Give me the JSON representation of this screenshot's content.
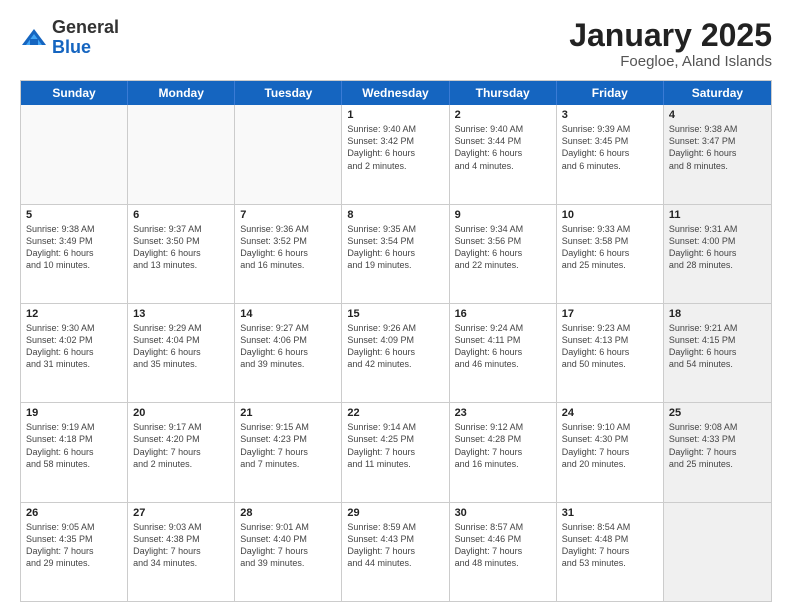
{
  "logo": {
    "general": "General",
    "blue": "Blue"
  },
  "title": "January 2025",
  "subtitle": "Foegloe, Aland Islands",
  "days": [
    "Sunday",
    "Monday",
    "Tuesday",
    "Wednesday",
    "Thursday",
    "Friday",
    "Saturday"
  ],
  "weeks": [
    [
      {
        "day": "",
        "info": "",
        "empty": true
      },
      {
        "day": "",
        "info": "",
        "empty": true
      },
      {
        "day": "",
        "info": "",
        "empty": true
      },
      {
        "day": "1",
        "info": "Sunrise: 9:40 AM\nSunset: 3:42 PM\nDaylight: 6 hours\nand 2 minutes."
      },
      {
        "day": "2",
        "info": "Sunrise: 9:40 AM\nSunset: 3:44 PM\nDaylight: 6 hours\nand 4 minutes."
      },
      {
        "day": "3",
        "info": "Sunrise: 9:39 AM\nSunset: 3:45 PM\nDaylight: 6 hours\nand 6 minutes."
      },
      {
        "day": "4",
        "info": "Sunrise: 9:38 AM\nSunset: 3:47 PM\nDaylight: 6 hours\nand 8 minutes.",
        "shaded": true
      }
    ],
    [
      {
        "day": "5",
        "info": "Sunrise: 9:38 AM\nSunset: 3:49 PM\nDaylight: 6 hours\nand 10 minutes."
      },
      {
        "day": "6",
        "info": "Sunrise: 9:37 AM\nSunset: 3:50 PM\nDaylight: 6 hours\nand 13 minutes."
      },
      {
        "day": "7",
        "info": "Sunrise: 9:36 AM\nSunset: 3:52 PM\nDaylight: 6 hours\nand 16 minutes."
      },
      {
        "day": "8",
        "info": "Sunrise: 9:35 AM\nSunset: 3:54 PM\nDaylight: 6 hours\nand 19 minutes."
      },
      {
        "day": "9",
        "info": "Sunrise: 9:34 AM\nSunset: 3:56 PM\nDaylight: 6 hours\nand 22 minutes."
      },
      {
        "day": "10",
        "info": "Sunrise: 9:33 AM\nSunset: 3:58 PM\nDaylight: 6 hours\nand 25 minutes."
      },
      {
        "day": "11",
        "info": "Sunrise: 9:31 AM\nSunset: 4:00 PM\nDaylight: 6 hours\nand 28 minutes.",
        "shaded": true
      }
    ],
    [
      {
        "day": "12",
        "info": "Sunrise: 9:30 AM\nSunset: 4:02 PM\nDaylight: 6 hours\nand 31 minutes."
      },
      {
        "day": "13",
        "info": "Sunrise: 9:29 AM\nSunset: 4:04 PM\nDaylight: 6 hours\nand 35 minutes."
      },
      {
        "day": "14",
        "info": "Sunrise: 9:27 AM\nSunset: 4:06 PM\nDaylight: 6 hours\nand 39 minutes."
      },
      {
        "day": "15",
        "info": "Sunrise: 9:26 AM\nSunset: 4:09 PM\nDaylight: 6 hours\nand 42 minutes."
      },
      {
        "day": "16",
        "info": "Sunrise: 9:24 AM\nSunset: 4:11 PM\nDaylight: 6 hours\nand 46 minutes."
      },
      {
        "day": "17",
        "info": "Sunrise: 9:23 AM\nSunset: 4:13 PM\nDaylight: 6 hours\nand 50 minutes."
      },
      {
        "day": "18",
        "info": "Sunrise: 9:21 AM\nSunset: 4:15 PM\nDaylight: 6 hours\nand 54 minutes.",
        "shaded": true
      }
    ],
    [
      {
        "day": "19",
        "info": "Sunrise: 9:19 AM\nSunset: 4:18 PM\nDaylight: 6 hours\nand 58 minutes."
      },
      {
        "day": "20",
        "info": "Sunrise: 9:17 AM\nSunset: 4:20 PM\nDaylight: 7 hours\nand 2 minutes."
      },
      {
        "day": "21",
        "info": "Sunrise: 9:15 AM\nSunset: 4:23 PM\nDaylight: 7 hours\nand 7 minutes."
      },
      {
        "day": "22",
        "info": "Sunrise: 9:14 AM\nSunset: 4:25 PM\nDaylight: 7 hours\nand 11 minutes."
      },
      {
        "day": "23",
        "info": "Sunrise: 9:12 AM\nSunset: 4:28 PM\nDaylight: 7 hours\nand 16 minutes."
      },
      {
        "day": "24",
        "info": "Sunrise: 9:10 AM\nSunset: 4:30 PM\nDaylight: 7 hours\nand 20 minutes."
      },
      {
        "day": "25",
        "info": "Sunrise: 9:08 AM\nSunset: 4:33 PM\nDaylight: 7 hours\nand 25 minutes.",
        "shaded": true
      }
    ],
    [
      {
        "day": "26",
        "info": "Sunrise: 9:05 AM\nSunset: 4:35 PM\nDaylight: 7 hours\nand 29 minutes."
      },
      {
        "day": "27",
        "info": "Sunrise: 9:03 AM\nSunset: 4:38 PM\nDaylight: 7 hours\nand 34 minutes."
      },
      {
        "day": "28",
        "info": "Sunrise: 9:01 AM\nSunset: 4:40 PM\nDaylight: 7 hours\nand 39 minutes."
      },
      {
        "day": "29",
        "info": "Sunrise: 8:59 AM\nSunset: 4:43 PM\nDaylight: 7 hours\nand 44 minutes."
      },
      {
        "day": "30",
        "info": "Sunrise: 8:57 AM\nSunset: 4:46 PM\nDaylight: 7 hours\nand 48 minutes."
      },
      {
        "day": "31",
        "info": "Sunrise: 8:54 AM\nSunset: 4:48 PM\nDaylight: 7 hours\nand 53 minutes."
      },
      {
        "day": "",
        "info": "",
        "empty": true,
        "shaded": true
      }
    ]
  ]
}
